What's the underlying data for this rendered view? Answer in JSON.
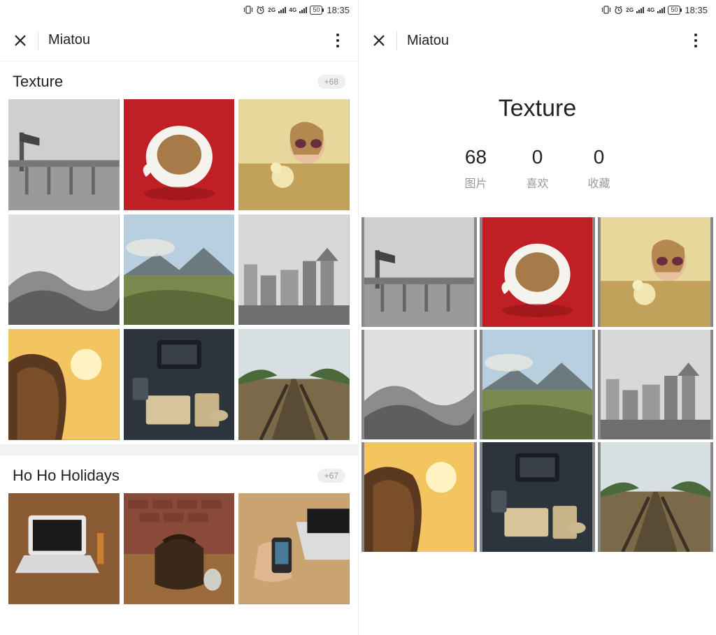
{
  "status": {
    "time": "18:35",
    "battery": "50",
    "net1": "2G",
    "net2": "4G"
  },
  "header": {
    "title": "Miatou"
  },
  "left": {
    "sections": [
      {
        "title": "Texture",
        "badge": "+68"
      },
      {
        "title": "Ho Ho Holidays",
        "badge": "+67"
      }
    ]
  },
  "right": {
    "title": "Texture",
    "stats": [
      {
        "num": "68",
        "label": "图片"
      },
      {
        "num": "0",
        "label": "喜欢"
      },
      {
        "num": "0",
        "label": "收藏"
      }
    ]
  }
}
